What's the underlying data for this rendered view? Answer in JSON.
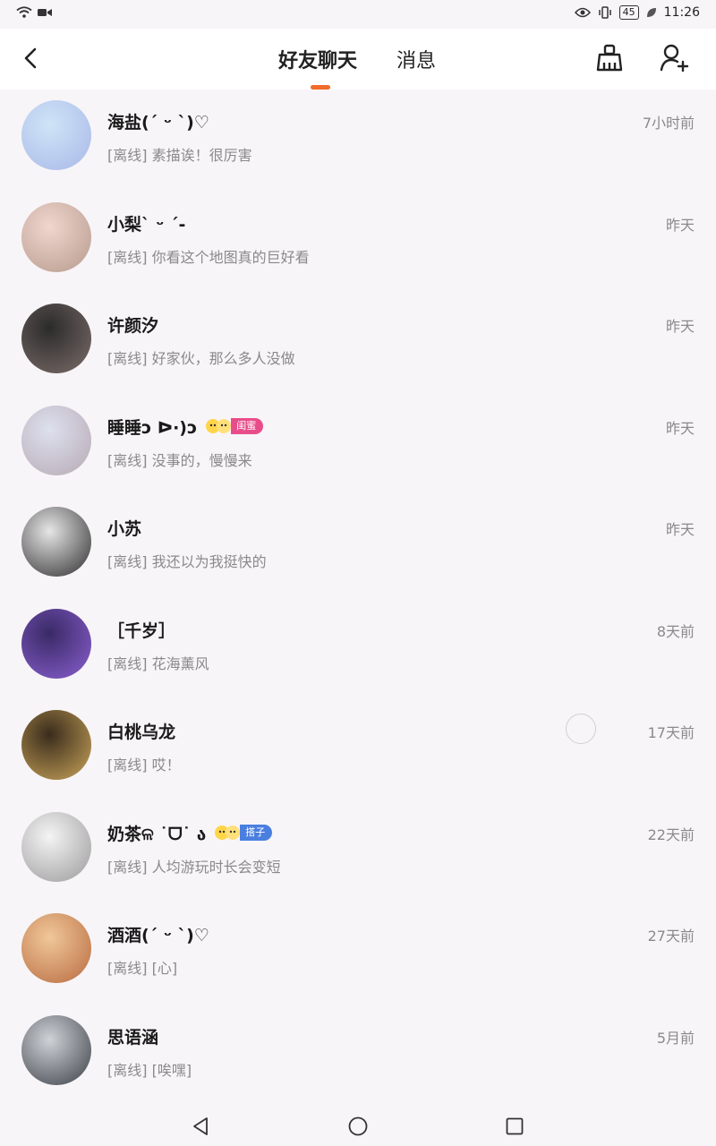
{
  "status_bar": {
    "time": "11:26",
    "battery": "45"
  },
  "header": {
    "back_icon": "back-arrow-icon",
    "tabs": [
      {
        "label": "好友聊天",
        "active": true
      },
      {
        "label": "消息",
        "active": false
      }
    ],
    "clean_icon": "broom-icon",
    "add_friend_icon": "add-user-icon",
    "accent_color": "#f26b2a"
  },
  "chats": [
    {
      "name": "海盐(ˊ ᵕ ˋ)♡",
      "preview": "[离线] 素描诶！很厉害",
      "time": "7小时前",
      "avatar_colors": [
        "#cfe4f7",
        "#a9b8e8"
      ]
    },
    {
      "name": "小梨ˋ ᵕ ˊ-",
      "preview": "[离线] 你看这个地图真的巨好看",
      "time": "昨天",
      "avatar_colors": [
        "#f1d6cf",
        "#b69a8c"
      ]
    },
    {
      "name": "许颜汐",
      "preview": "[离线] 好家伙，那么多人没做",
      "time": "昨天",
      "avatar_colors": [
        "#2b2b2b",
        "#7c6d6a"
      ]
    },
    {
      "name": "睡睡ↄ ᐅ·)ↄ",
      "preview": "[离线] 没事的，慢慢来",
      "time": "昨天",
      "avatar_colors": [
        "#dde0ee",
        "#b7a9b4"
      ],
      "badge": {
        "label": "闺蜜",
        "color": "#e84d8a"
      }
    },
    {
      "name": "小苏",
      "preview": "[离线] 我还以为我挺快的",
      "time": "昨天",
      "avatar_colors": [
        "#e6e6e6",
        "#2d2d2d"
      ]
    },
    {
      "name": "［千岁］",
      "preview": "[离线] 花海薰风",
      "time": "8天前",
      "avatar_colors": [
        "#3a2a66",
        "#8a5fd0"
      ]
    },
    {
      "name": "白桃乌龙",
      "preview": "[离线] 哎！",
      "time": "17天前",
      "avatar_colors": [
        "#3a2c1c",
        "#caa55a"
      ]
    },
    {
      "name": "奶茶ଳ ˙ᗜ˙ ა",
      "preview": "[离线] 人均游玩时长会变短",
      "time": "22天前",
      "avatar_colors": [
        "#f4f4f4",
        "#9a9a9a"
      ],
      "badge": {
        "label": "搭子",
        "color": "#4a7fe0"
      }
    },
    {
      "name": "酒酒(ˊ ᵕ ˋ)♡",
      "preview": "[离线] [心]",
      "time": "27天前",
      "avatar_colors": [
        "#f0c79a",
        "#b86b3f"
      ]
    },
    {
      "name": "思语涵",
      "preview": "[离线] [唉嘿]",
      "time": "5月前",
      "avatar_colors": [
        "#cfd3d8",
        "#3b3f46"
      ]
    }
  ],
  "nav_bar": {
    "back_icon": "nav-back-triangle-icon",
    "home_icon": "nav-home-circle-icon",
    "recents_icon": "nav-recents-square-icon"
  }
}
